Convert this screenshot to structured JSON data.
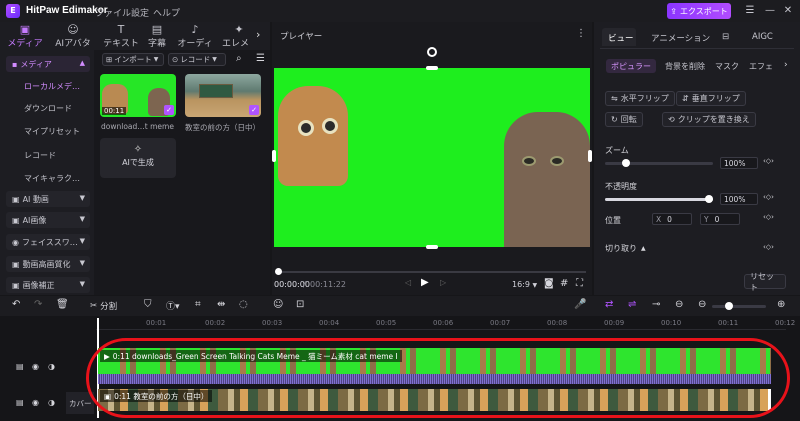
{
  "app": {
    "title": "HitPaw Edimakor",
    "menus": [
      "ファイル",
      "設定",
      "ヘルプ"
    ],
    "export_label": "エクスポート"
  },
  "toolbar": {
    "tabs": [
      {
        "label": "メディア",
        "icon": "media-icon"
      },
      {
        "label": "AIアバター",
        "icon": "avatar-icon"
      },
      {
        "label": "テキスト",
        "icon": "text-icon"
      },
      {
        "label": "字幕",
        "icon": "subtitle-icon"
      },
      {
        "label": "オーディオ",
        "icon": "audio-icon"
      },
      {
        "label": "エレメ",
        "icon": "element-icon"
      }
    ]
  },
  "leftnav": {
    "media_label": "メディア",
    "sub_items": [
      "ローカルメデ…",
      "ダウンロード",
      "マイプリセット",
      "レコード",
      "マイキャラク…"
    ],
    "groups": [
      "AI 動画",
      "AI画像",
      "フェイススワ…",
      "動画高画質化",
      "画像補正"
    ]
  },
  "media_panel": {
    "import_label": "インポート",
    "record_label": "レコード",
    "items": [
      {
        "name": "download…t meme I",
        "duration": "00:11"
      },
      {
        "name": "教室の前の方（日中）",
        "duration": ""
      }
    ],
    "ai_generate_label": "AIで生成"
  },
  "player": {
    "title": "プレイヤー",
    "current_time": "00:00:00",
    "total_time": "00:11:22",
    "aspect": "16:9"
  },
  "right_panel": {
    "tabs": [
      "ビュー",
      "アニメーション",
      "AIGC"
    ],
    "subtabs": [
      "ポピュラー",
      "背景を削除",
      "マスク",
      "エフェ"
    ],
    "buttons": [
      "水平フリップ",
      "垂直フリップ",
      "回転",
      "クリップを置き換え"
    ],
    "zoom_label": "ズーム",
    "zoom_value": "100%",
    "opacity_label": "不透明度",
    "opacity_value": "100%",
    "position_label": "位置",
    "pos_x_label": "X",
    "pos_x": "0",
    "pos_y_label": "Y",
    "pos_y": "0",
    "crop_label": "切り取り",
    "reset_label": "リセット"
  },
  "timeline": {
    "split_label": "分割",
    "ticks": [
      "00:01",
      "00:02",
      "00:03",
      "00:04",
      "00:05",
      "00:06",
      "00:07",
      "00:08",
      "00:09",
      "00:10",
      "00:11",
      "00:12"
    ],
    "track1_label": "0:11 downloads_Green Screen Talking Cats Meme _ 猫ミーム素材 cat meme I",
    "track2_label": "0:11 教室の前の方（日中）",
    "cover_label": "カバー"
  },
  "colors": {
    "accent": "#b054ff",
    "green": "#1eee1e",
    "highlight": "#e8121a"
  }
}
